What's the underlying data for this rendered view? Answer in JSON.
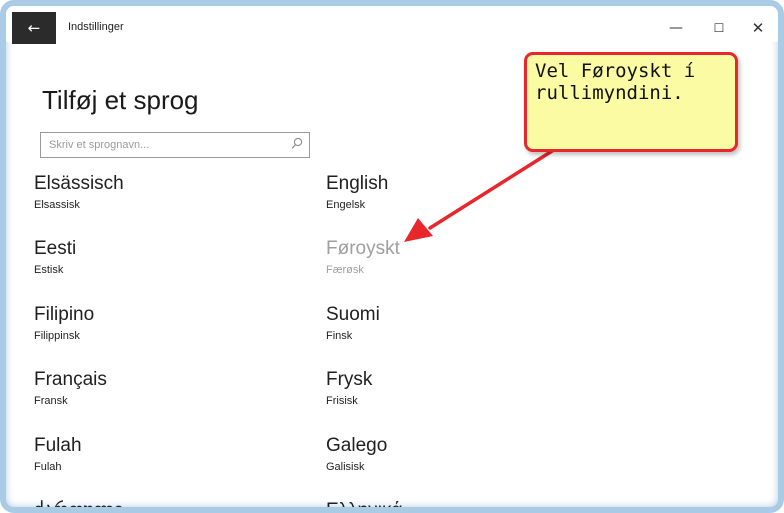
{
  "window": {
    "title": "Indstillinger",
    "back_icon": "←",
    "minimize_icon": "—",
    "maximize_icon": "☐",
    "close_icon": "✕"
  },
  "page": {
    "title": "Tilføj et sprog",
    "search_placeholder": "Skriv et sprognavn..."
  },
  "languages": {
    "left": [
      {
        "name": "Elsässisch",
        "sub": "Elsassisk"
      },
      {
        "name": "Eesti",
        "sub": "Estisk"
      },
      {
        "name": "Filipino",
        "sub": "Filippinsk"
      },
      {
        "name": "Français",
        "sub": "Fransk"
      },
      {
        "name": "Fulah",
        "sub": "Fulah"
      },
      {
        "name": "ქართული",
        "sub": ""
      }
    ],
    "right": [
      {
        "name": "English",
        "sub": "Engelsk"
      },
      {
        "name": "Føroyskt",
        "sub": "Færøsk"
      },
      {
        "name": "Suomi",
        "sub": "Finsk"
      },
      {
        "name": "Frysk",
        "sub": "Frisisk"
      },
      {
        "name": "Galego",
        "sub": "Galisisk"
      },
      {
        "name": "Ελληνικά",
        "sub": ""
      }
    ]
  },
  "callout": {
    "line1": "Vel Føroyskt í",
    "line2": "rullimyndini."
  },
  "colors": {
    "callout_bg": "#fbfba3",
    "callout_border": "#e8262b",
    "arrow": "#e8262b",
    "disabled_text": "#9f9f9f"
  }
}
